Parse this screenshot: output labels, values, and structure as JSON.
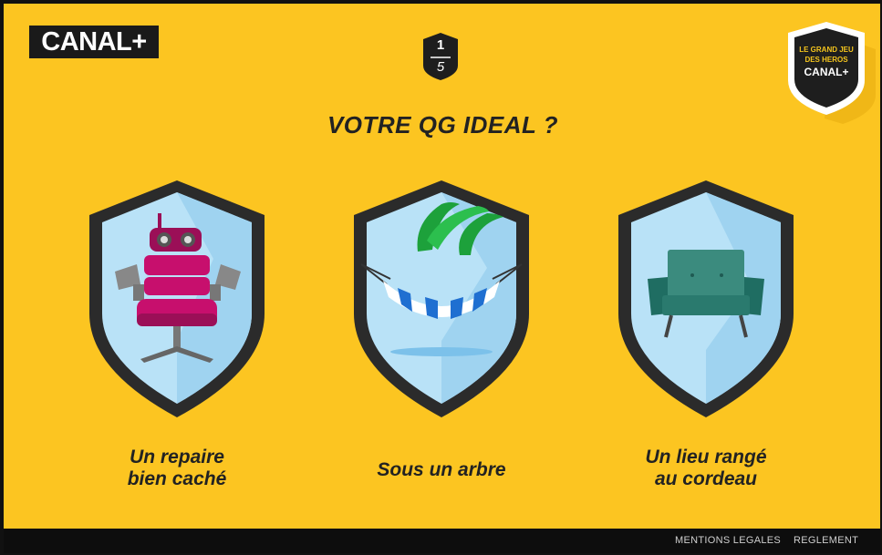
{
  "brand": {
    "logo_text": "CANAL+"
  },
  "progress": {
    "current": "1",
    "total": "5"
  },
  "badge": {
    "line1": "LE GRAND JEU",
    "line2": "DES HEROS",
    "line3": "CANAL+"
  },
  "question": "VOTRE QG IDEAL ?",
  "answers": [
    {
      "label_line1": "Un repaire",
      "label_line2": "bien caché",
      "icon": "armchair-robot-icon"
    },
    {
      "label_line1": "Sous un arbre",
      "label_line2": "",
      "icon": "hammock-palm-icon"
    },
    {
      "label_line1": "Un lieu rangé",
      "label_line2": "au cordeau",
      "icon": "armchair-icon"
    }
  ],
  "footer": {
    "legal": "MENTIONS LEGALES",
    "rules": "REGLEMENT"
  },
  "colors": {
    "background": "#fcc521",
    "shield_border": "#2b2b2b",
    "shield_fill": "#b9e2f7",
    "footer": "#0d0d0d"
  }
}
